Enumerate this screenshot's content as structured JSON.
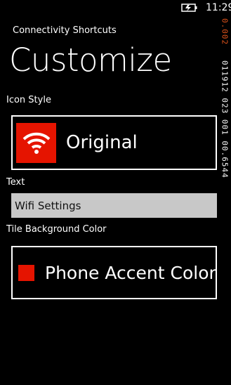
{
  "status_bar": {
    "time": "11:29",
    "battery_icon": "battery-charging-icon"
  },
  "memory_counter": {
    "value_a": "0.002",
    "value_b": "011912 023 001 00.6544"
  },
  "header": {
    "app_title": "Connectivity Shortcuts",
    "page_title": "Customize"
  },
  "icon_style": {
    "label": "Icon Style",
    "value": "Original",
    "icon": "wifi-icon",
    "tile_color": "#e51400"
  },
  "text_field": {
    "label": "Text",
    "value": "Wifi Settings"
  },
  "tile_background": {
    "label": "Tile Background Color",
    "value": "Phone Accent Color",
    "swatch_color": "#e51400"
  },
  "colors": {
    "background": "#000000",
    "accent": "#e51400",
    "input_background": "#c8c8c8",
    "counter_orange": "#e2541b"
  }
}
